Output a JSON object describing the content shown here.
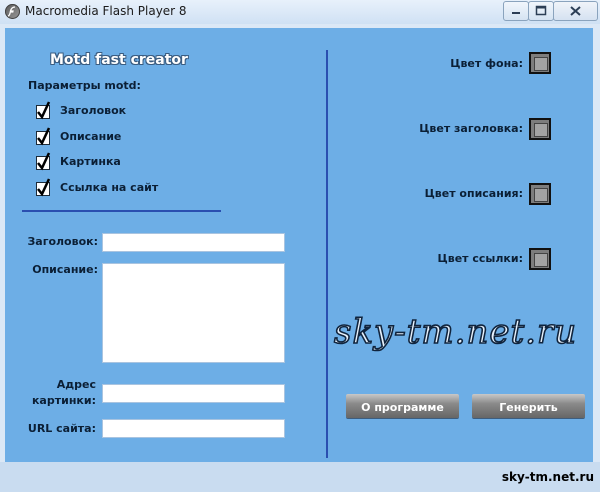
{
  "window": {
    "title": "Macromedia Flash Player 8"
  },
  "app": {
    "title": "Motd fast creator",
    "params_label": "Параметры motd:",
    "options": [
      {
        "label": "Заголовок",
        "checked": true
      },
      {
        "label": "Описание",
        "checked": true
      },
      {
        "label": "Картинка",
        "checked": true
      },
      {
        "label": "Ссылка на сайт",
        "checked": true
      }
    ],
    "form": {
      "title_label": "Заголовок:",
      "description_label": "Описание:",
      "image_label_1": "Адрес",
      "image_label_2": "картинки:",
      "url_label": "URL сайта:",
      "title_value": "",
      "description_value": "",
      "image_value": "",
      "url_value": ""
    },
    "colors": {
      "bg_label": "Цвет фона:",
      "title_label": "Цвет заголовка:",
      "description_label": "Цвет описания:",
      "link_label": "Цвет ссылки:"
    },
    "buttons": {
      "about": "О программе",
      "generate": "Генерить"
    },
    "watermark": "sky-tm.net.ru"
  },
  "footer": {
    "site": "sky-tm.net.ru"
  },
  "palette": {
    "background": "#6daee6",
    "separator": "#2a4fb0"
  }
}
